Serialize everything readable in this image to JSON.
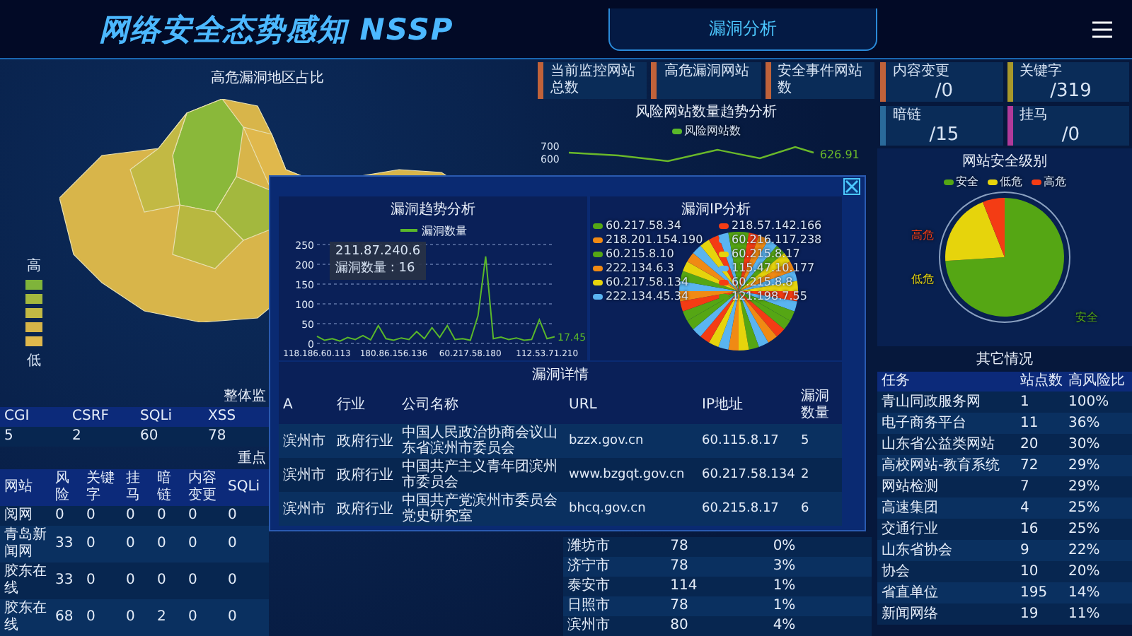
{
  "header": {
    "title": "网络安全态势感知 NSSP",
    "page_tab": "漏洞分析"
  },
  "map": {
    "title": "高危漏洞地区占比",
    "legend_high": "高",
    "legend_low": "低",
    "swatches": [
      {
        "color": "#7fb43a"
      },
      {
        "color": "#a3b83e"
      },
      {
        "color": "#c2b944"
      },
      {
        "color": "#d6b448"
      },
      {
        "color": "#e0b84c"
      }
    ]
  },
  "overall": {
    "title": "整体监",
    "columns": [
      "CGI",
      "CSRF",
      "SQLi",
      "XSS"
    ],
    "values": [
      "5",
      "2",
      "60",
      "78"
    ]
  },
  "key_sites": {
    "title": "重点",
    "columns": [
      "网站",
      "风险",
      "关键字",
      "挂马",
      "暗链",
      "内容变更",
      "SQLi"
    ],
    "rows": [
      [
        "阅网",
        "0",
        "0",
        "0",
        "0",
        "0",
        "0"
      ],
      [
        "青岛新闻网",
        "33",
        "0",
        "0",
        "0",
        "0",
        "0"
      ],
      [
        "胶东在线",
        "33",
        "0",
        "0",
        "0",
        "0",
        "0"
      ],
      [
        "胶东在线",
        "68",
        "0",
        "0",
        "2",
        "0",
        "0"
      ]
    ]
  },
  "monitor_cards": [
    {
      "label": "当前监控网站总数",
      "color": "#c0623a"
    },
    {
      "label": "高危漏洞网站",
      "color": "#c0623a"
    },
    {
      "label": "安全事件网站数",
      "color": "#c0623a"
    }
  ],
  "risk_trend": {
    "title": "风险网站数量趋势分析",
    "legend": "风险网站数",
    "ticks": [
      "700",
      "600"
    ],
    "end_label": "626.91"
  },
  "city_table": {
    "rows": [
      [
        "潍坊市",
        "78",
        "0%"
      ],
      [
        "济宁市",
        "78",
        "3%"
      ],
      [
        "泰安市",
        "114",
        "1%"
      ],
      [
        "日照市",
        "78",
        "1%"
      ],
      [
        "滨州市",
        "80",
        "4%"
      ]
    ]
  },
  "threat_cards": [
    {
      "label": "内容变更",
      "value": "/0",
      "color": "#c0623a"
    },
    {
      "label": "关键字",
      "value": "/319",
      "color": "#a8982a"
    },
    {
      "label": "暗链",
      "value": "/15",
      "color": "#2a6a9a"
    },
    {
      "label": "挂马",
      "value": "/0",
      "color": "#b03a9a"
    }
  ],
  "security_pie": {
    "title": "网站安全级别",
    "slices": [
      {
        "legend": "安全",
        "callout": "安全",
        "color": "#55a614"
      },
      {
        "legend": "低危",
        "callout": "低危",
        "color": "#e6d40c"
      },
      {
        "legend": "高危",
        "callout": "高危",
        "color": "#f43c14"
      }
    ]
  },
  "other": {
    "title": "其它情况",
    "columns": [
      "任务",
      "站点数",
      "高风险比"
    ],
    "rows": [
      [
        "青山同政服务网",
        "1",
        "100%"
      ],
      [
        "电子商务平台",
        "11",
        "36%"
      ],
      [
        "山东省公益类网站",
        "20",
        "30%"
      ],
      [
        "高校网站-教育系统",
        "72",
        "29%"
      ],
      [
        "网站检测",
        "7",
        "29%"
      ],
      [
        "高速集团",
        "4",
        "25%"
      ],
      [
        "交通行业",
        "16",
        "25%"
      ],
      [
        "山东省协会",
        "9",
        "22%"
      ],
      [
        "协会",
        "10",
        "20%"
      ],
      [
        "省直单位",
        "195",
        "14%"
      ],
      [
        "新闻网络",
        "19",
        "11%"
      ]
    ]
  },
  "modal": {
    "trend": {
      "chart_data": {
        "type": "line",
        "title": "漏洞趋势分析",
        "categories": [
          "118.186.60.113",
          null,
          null,
          null,
          null,
          null,
          null,
          null,
          null,
          null,
          "180.86.156.136",
          null,
          null,
          null,
          null,
          null,
          null,
          null,
          null,
          null,
          "60.217.58.180",
          null,
          null,
          null,
          null,
          null,
          null,
          null,
          null,
          null,
          "112.53.71.210",
          null
        ],
        "series": [
          {
            "name": "漏洞数量",
            "color": "#5ab82a",
            "values": [
              18,
              8,
              12,
              6,
              15,
              10,
              20,
              9,
              45,
              12,
              8,
              14,
              10,
              30,
              12,
              40,
              15,
              45,
              10,
              12,
              8,
              70,
              220,
              12,
              16,
              10,
              14,
              8,
              10,
              60,
              12,
              17
            ]
          }
        ],
        "ylim": [
          0,
          250
        ],
        "yticks": [
          0,
          50,
          100,
          150,
          200,
          250
        ],
        "grid": true,
        "annotations": [
          "17.45"
        ]
      },
      "tooltip": {
        "title": "211.87.240.6",
        "label": "漏洞数量 : 16"
      }
    },
    "ip_pie": {
      "title": "漏洞IP分析",
      "labels": [
        {
          "text": "60.217.58.34",
          "color": "#55a614"
        },
        {
          "text": "218.57.142.166",
          "color": "#f43c14"
        },
        {
          "text": "218.201.154.190",
          "color": "#f08a14"
        },
        {
          "text": "60.216.117.238",
          "color": "#5ab4f0"
        },
        {
          "text": "60.215.8.10",
          "color": "#55a614"
        },
        {
          "text": "60.215.8.17",
          "color": "#e6d40c"
        },
        {
          "text": "222.134.6.3",
          "color": "#f08a14"
        },
        {
          "text": "115.47.10.177",
          "color": "#5ab4f0"
        },
        {
          "text": "60.217.58.134",
          "color": "#e6d40c"
        },
        {
          "text": "60.215.8.8",
          "color": "#f43c14"
        },
        {
          "text": "222.134.45.34",
          "color": "#5ab4f0"
        },
        {
          "text": "121.198.7.55",
          "color": "#55a614"
        }
      ]
    },
    "details": {
      "title": "漏洞详情",
      "columns": [
        "A",
        "行业",
        "公司名称",
        "URL",
        "IP地址",
        "漏洞数量"
      ],
      "rows": [
        [
          "滨州市",
          "政府行业",
          "中国人民政治协商会议山东省滨州市委员会",
          "bzzx.gov.cn",
          "60.115.8.17",
          "5"
        ],
        [
          "滨州市",
          "政府行业",
          "中国共产主义青年团滨州市委员会",
          "www.bzgqt.gov.cn",
          "60.217.58.134",
          "2"
        ],
        [
          "滨州市",
          "政府行业",
          "中国共产党滨州市委员会党史研究室",
          "bhcq.gov.cn",
          "60.215.8.17",
          "6"
        ]
      ]
    }
  }
}
